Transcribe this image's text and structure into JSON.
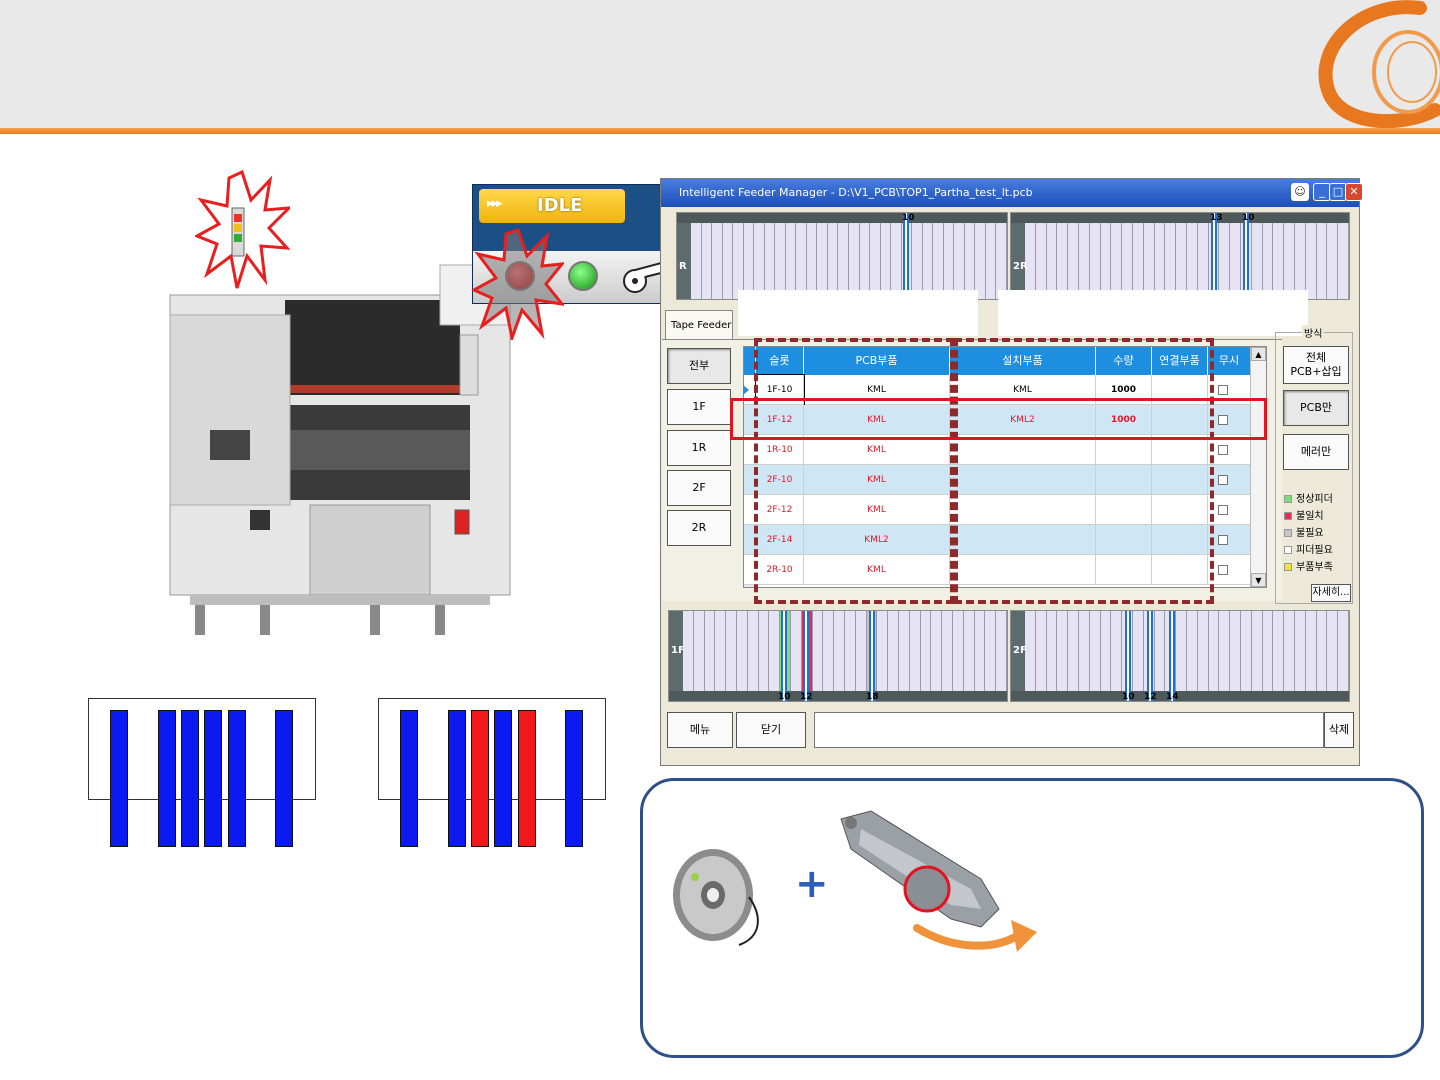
{
  "idle_panel": {
    "status": "IDLE",
    "arrows": "▸▸▸"
  },
  "window": {
    "title": "Intelligent Feeder Manager - D:\\V1_PCB\\TOP1_Partha_test_lt.pcb",
    "tab": "Tape Feeder",
    "top_strip": {
      "rear_label": "R",
      "rear2_label": "2R",
      "markers_left": [
        "10"
      ],
      "markers_right": [
        "13",
        "10"
      ]
    },
    "bottom_strip": {
      "front_label": "1F",
      "front2_label": "2F",
      "markers_left": [
        "10",
        "12",
        "18"
      ],
      "markers_right": [
        "10",
        "12",
        "14"
      ]
    },
    "side_buttons": [
      "전부",
      "1F",
      "1R",
      "2F",
      "2R"
    ],
    "grid": {
      "headers": [
        "슬롯",
        "PCB부품",
        "설치부품",
        "수량",
        "연결부품",
        "무시"
      ],
      "rows": [
        {
          "slot": "1F-10",
          "pcb": "KML",
          "installed": "KML",
          "qty": "1000",
          "linked": "",
          "red": false
        },
        {
          "slot": "1F-12",
          "pcb": "KML",
          "installed": "KML2",
          "qty": "1000",
          "linked": "",
          "red": true
        },
        {
          "slot": "1R-10",
          "pcb": "KML",
          "installed": "",
          "qty": "",
          "linked": "",
          "red": true
        },
        {
          "slot": "2F-10",
          "pcb": "KML",
          "installed": "",
          "qty": "",
          "linked": "",
          "red": true
        },
        {
          "slot": "2F-12",
          "pcb": "KML",
          "installed": "",
          "qty": "",
          "linked": "",
          "red": true
        },
        {
          "slot": "2F-14",
          "pcb": "KML2",
          "installed": "",
          "qty": "",
          "linked": "",
          "red": true
        },
        {
          "slot": "2R-10",
          "pcb": "KML",
          "installed": "",
          "qty": "",
          "linked": "",
          "red": true
        }
      ]
    },
    "mode": {
      "title": "방식",
      "buttons": [
        "전체\nPCB+삽입",
        "PCB만",
        "메러만"
      ],
      "legend": [
        {
          "label": "정상피더",
          "color": "#7ddc7d"
        },
        {
          "label": "불일치",
          "color": "#e0305a"
        },
        {
          "label": "불필요",
          "color": "#c4c4c4"
        },
        {
          "label": "피더필요",
          "color": "#ffffff"
        },
        {
          "label": "부품부족",
          "color": "#f5e23a"
        }
      ],
      "detail_button": "자세히..."
    },
    "bottom_buttons": {
      "menu": "메뉴",
      "close": "닫기",
      "delete": "삭제"
    }
  },
  "bar_diagrams": {
    "left": [
      "blue",
      "blue",
      "blue",
      "blue",
      "blue",
      "blue"
    ],
    "right": [
      "blue",
      "blue",
      "red",
      "blue",
      "red",
      "blue"
    ]
  },
  "colors": {
    "accent_orange": "#e8781f",
    "grid_header": "#1e8fe0",
    "error_red": "#e0182a",
    "callout_border": "#2d4f8a"
  }
}
